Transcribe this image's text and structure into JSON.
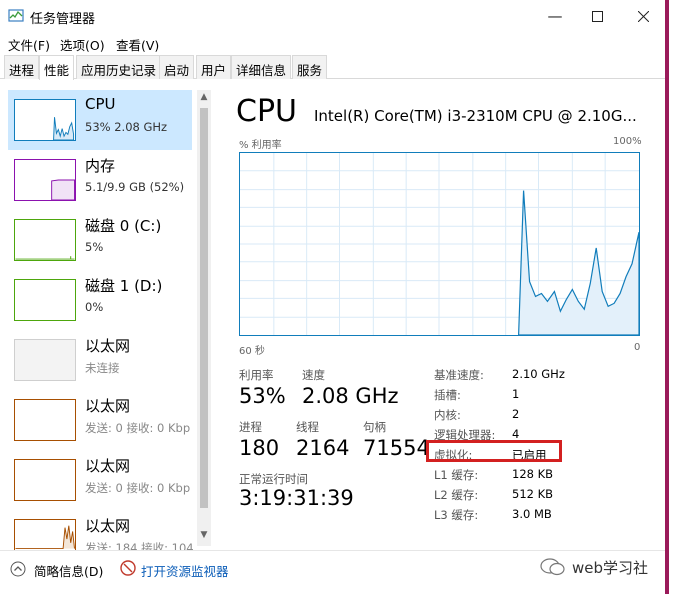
{
  "window": {
    "title": "任务管理器"
  },
  "menu": [
    "文件(F)",
    "选项(O)",
    "查看(V)"
  ],
  "tabs": [
    "进程",
    "性能",
    "应用历史记录",
    "启动",
    "用户",
    "详细信息",
    "服务"
  ],
  "sidebar": {
    "items": [
      {
        "name": "CPU",
        "sub": "53% 2.08 GHz"
      },
      {
        "name": "内存",
        "sub": "5.1/9.9 GB (52%)"
      },
      {
        "name": "磁盘 0 (C:)",
        "sub": "5%"
      },
      {
        "name": "磁盘 1 (D:)",
        "sub": "0%"
      },
      {
        "name": "以太网",
        "sub": "未连接"
      },
      {
        "name": "以太网",
        "sub": "发送: 0 接收: 0 Kbp"
      },
      {
        "name": "以太网",
        "sub": "发送: 0 接收: 0 Kbp"
      },
      {
        "name": "以太网",
        "sub": "发送: 184 接收: 104"
      }
    ]
  },
  "main": {
    "title": "CPU",
    "processor": "Intel(R) Core(TM) i3-2310M CPU @ 2.10G...",
    "graph_label_left": "% 利用率",
    "graph_label_right": "100%",
    "graph_time_left": "60 秒",
    "graph_time_right": "0",
    "stats": {
      "utilization_label": "利用率",
      "utilization": "53%",
      "speed_label": "速度",
      "speed": "2.08 GHz",
      "processes_label": "进程",
      "processes": "180",
      "threads_label": "线程",
      "threads": "2164",
      "handles_label": "句柄",
      "handles": "71554",
      "uptime_label": "正常运行时间",
      "uptime": "3:19:31:39"
    },
    "info": [
      {
        "label": "基准速度:",
        "value": "2.10 GHz"
      },
      {
        "label": "插槽:",
        "value": "1"
      },
      {
        "label": "内核:",
        "value": "2"
      },
      {
        "label": "逻辑处理器:",
        "value": "4"
      },
      {
        "label": "虚拟化:",
        "value": "已启用"
      },
      {
        "label": "L1 缓存:",
        "value": "128 KB"
      },
      {
        "label": "L2 缓存:",
        "value": "512 KB"
      },
      {
        "label": "L3 缓存:",
        "value": "3.0 MB"
      }
    ]
  },
  "footer": {
    "brief_label": "简略信息(D)",
    "monitor_label": "打开资源监视器"
  },
  "watermark": "web学习社",
  "colors": {
    "cpu_line": "#117dbb",
    "memory": "#8b12ae",
    "disk": "#4da60c",
    "ethernet": "#a74f01",
    "highlight": "#d32020",
    "selected_bg": "#cce8ff"
  }
}
